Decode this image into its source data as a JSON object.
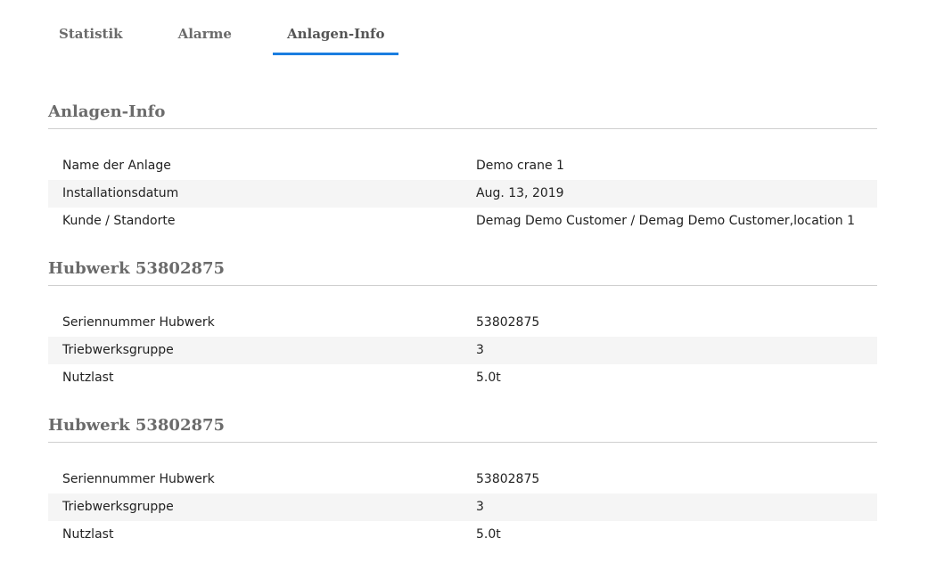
{
  "tabs": [
    {
      "label": "Statistik",
      "active": false
    },
    {
      "label": "Alarme",
      "active": false
    },
    {
      "label": "Anlagen-Info",
      "active": true
    }
  ],
  "accent_color": "#1a7ee0",
  "sections": [
    {
      "title": "Anlagen-Info",
      "rows": [
        {
          "label": "Name der Anlage",
          "value": "Demo crane 1"
        },
        {
          "label": "Installationsdatum",
          "value": "Aug. 13, 2019"
        },
        {
          "label": "Kunde / Standorte",
          "value": "Demag Demo Customer / Demag Demo Customer,location 1"
        }
      ]
    },
    {
      "title": "Hubwerk 53802875",
      "rows": [
        {
          "label": "Seriennummer Hubwerk",
          "value": "53802875"
        },
        {
          "label": "Triebwerksgruppe",
          "value": "3"
        },
        {
          "label": "Nutzlast",
          "value": "5.0t"
        }
      ]
    },
    {
      "title": "Hubwerk 53802875",
      "rows": [
        {
          "label": "Seriennummer Hubwerk",
          "value": "53802875"
        },
        {
          "label": "Triebwerksgruppe",
          "value": "3"
        },
        {
          "label": "Nutzlast",
          "value": "5.0t"
        }
      ]
    }
  ]
}
